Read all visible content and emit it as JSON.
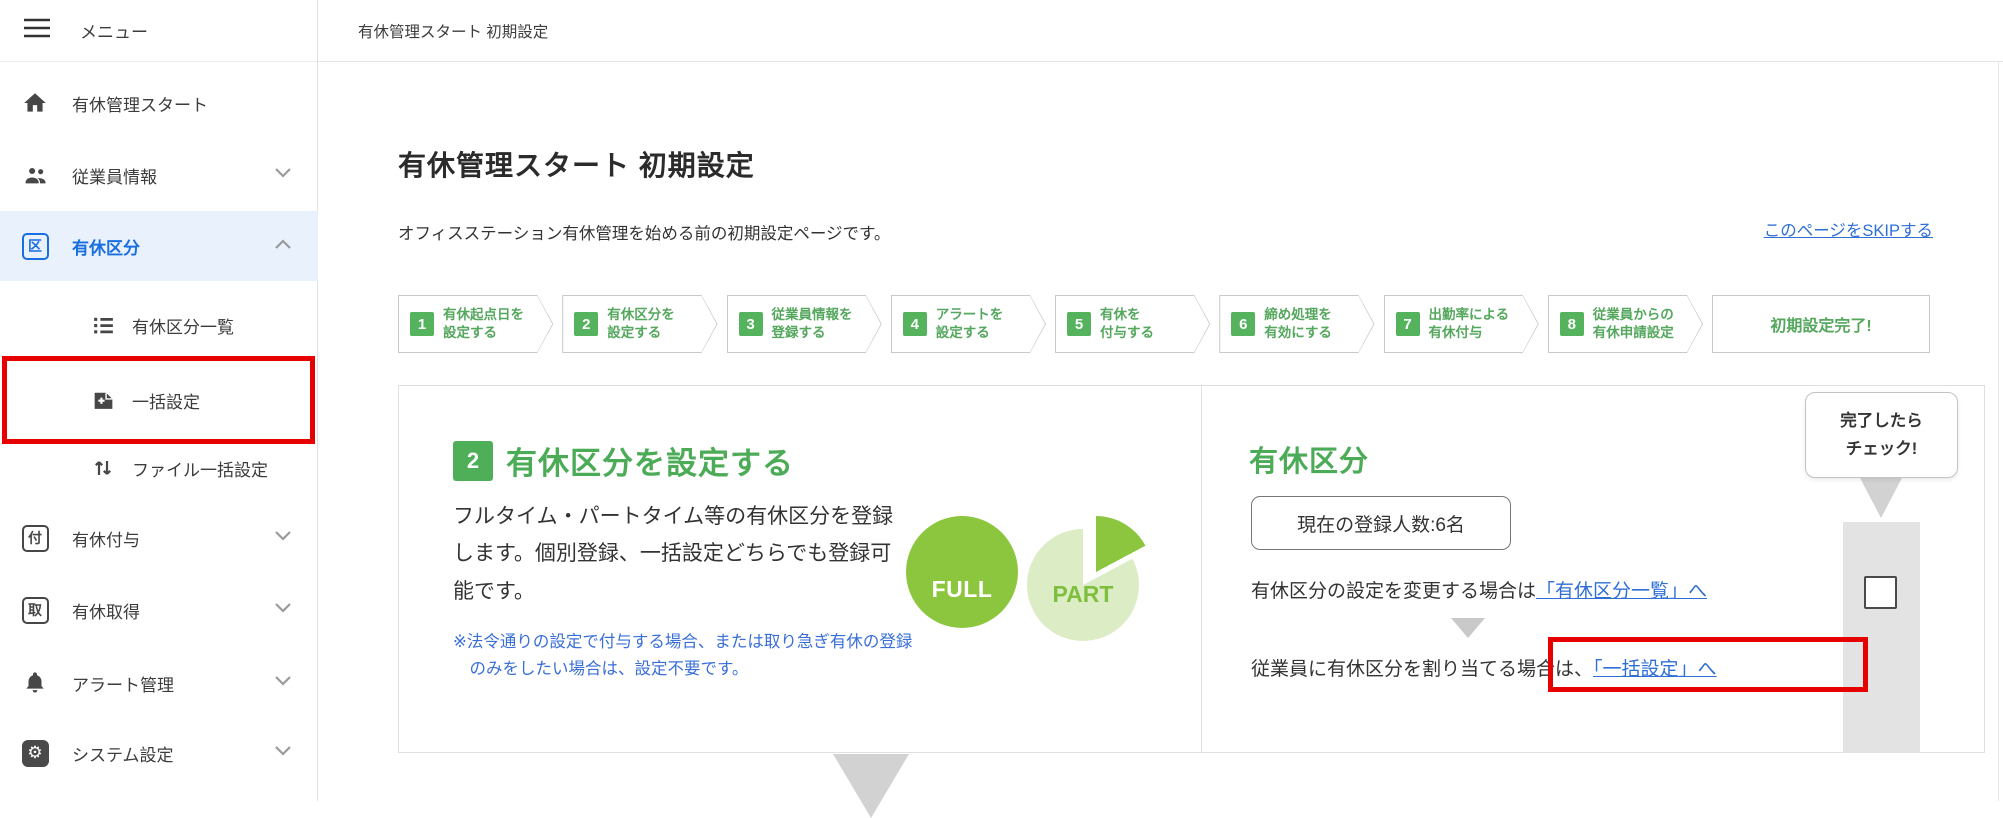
{
  "app": {
    "topbar_title": "有休管理スタート 初期設定"
  },
  "sidebar": {
    "menu_label": "メニュー",
    "items": [
      {
        "label": "有休管理スタート",
        "icon": "home-icon"
      },
      {
        "label": "従業員情報",
        "icon": "people-icon",
        "chevron": "down"
      },
      {
        "label": "有休区分",
        "icon": "boxed-char-icon",
        "icon_char": "区",
        "chevron": "up",
        "active": true
      },
      {
        "label": "有休区分一覧",
        "icon": "list-icon",
        "sub": true
      },
      {
        "label": "一括設定",
        "icon": "note-add-icon",
        "sub": true,
        "highlighted": true
      },
      {
        "label": "ファイル一括設定",
        "icon": "import-export-icon",
        "sub": true
      },
      {
        "label": "有休付与",
        "icon": "boxed-char-icon",
        "icon_char": "付",
        "chevron": "down"
      },
      {
        "label": "有休取得",
        "icon": "boxed-char-icon",
        "icon_char": "取",
        "chevron": "down"
      },
      {
        "label": "アラート管理",
        "icon": "bell-icon",
        "chevron": "down"
      },
      {
        "label": "システム設定",
        "icon": "gear-icon",
        "chevron": "down"
      }
    ]
  },
  "icons": {
    "gear_glyph": "⚙"
  },
  "page": {
    "title": "有休管理スタート 初期設定",
    "description": "オフィスステーション有休管理を始める前の初期設定ページです。",
    "skip_link": "このページをSKIPする"
  },
  "steps": {
    "items": [
      {
        "num": "1",
        "line1": "有休起点日を",
        "line2": "設定する"
      },
      {
        "num": "2",
        "line1": "有休区分を",
        "line2": "設定する"
      },
      {
        "num": "3",
        "line1": "従業員情報を",
        "line2": "登録する"
      },
      {
        "num": "4",
        "line1": "アラートを",
        "line2": "設定する"
      },
      {
        "num": "5",
        "line1": "有休を",
        "line2": "付与する"
      },
      {
        "num": "6",
        "line1": "締め処理を",
        "line2": "有効にする"
      },
      {
        "num": "7",
        "line1": "出勤率による",
        "line2": "有休付与"
      },
      {
        "num": "8",
        "line1": "従業員からの",
        "line2": "有休申請設定"
      }
    ],
    "final_label": "初期設定完了!"
  },
  "card": {
    "left": {
      "step_num": "2",
      "heading": "有休区分を設定する",
      "body": "フルタイム・パートタイム等の有休区分を登録します。個別登録、一括設定どちらでも登録可能です。",
      "note": "※法令通りの設定で付与する場合、または取り急ぎ有休の登録のみをしたい場合は、設定不要です。",
      "chart_full_label": "FULL",
      "chart_part_label": "PART"
    },
    "right": {
      "heading": "有休区分",
      "count_box": "現在の登録人数:6名",
      "line1_prefix": "有休区分の設定を変更する場合は",
      "line1_link": "「有休区分一覧」へ",
      "line2_prefix": "従業員に有休区分を割り当てる場合は、",
      "line2_link": "「一括設定」へ"
    },
    "check": {
      "bubble_line1": "完了したら",
      "bubble_line2": "チェック!"
    }
  },
  "colors": {
    "accent_green": "#4fae58",
    "chart_green": "#8cc63e",
    "chart_pale_green": "#dcecc5",
    "link_blue": "#2e6fd6",
    "active_blue": "#1a6fe0",
    "highlight_red": "#e60000"
  }
}
